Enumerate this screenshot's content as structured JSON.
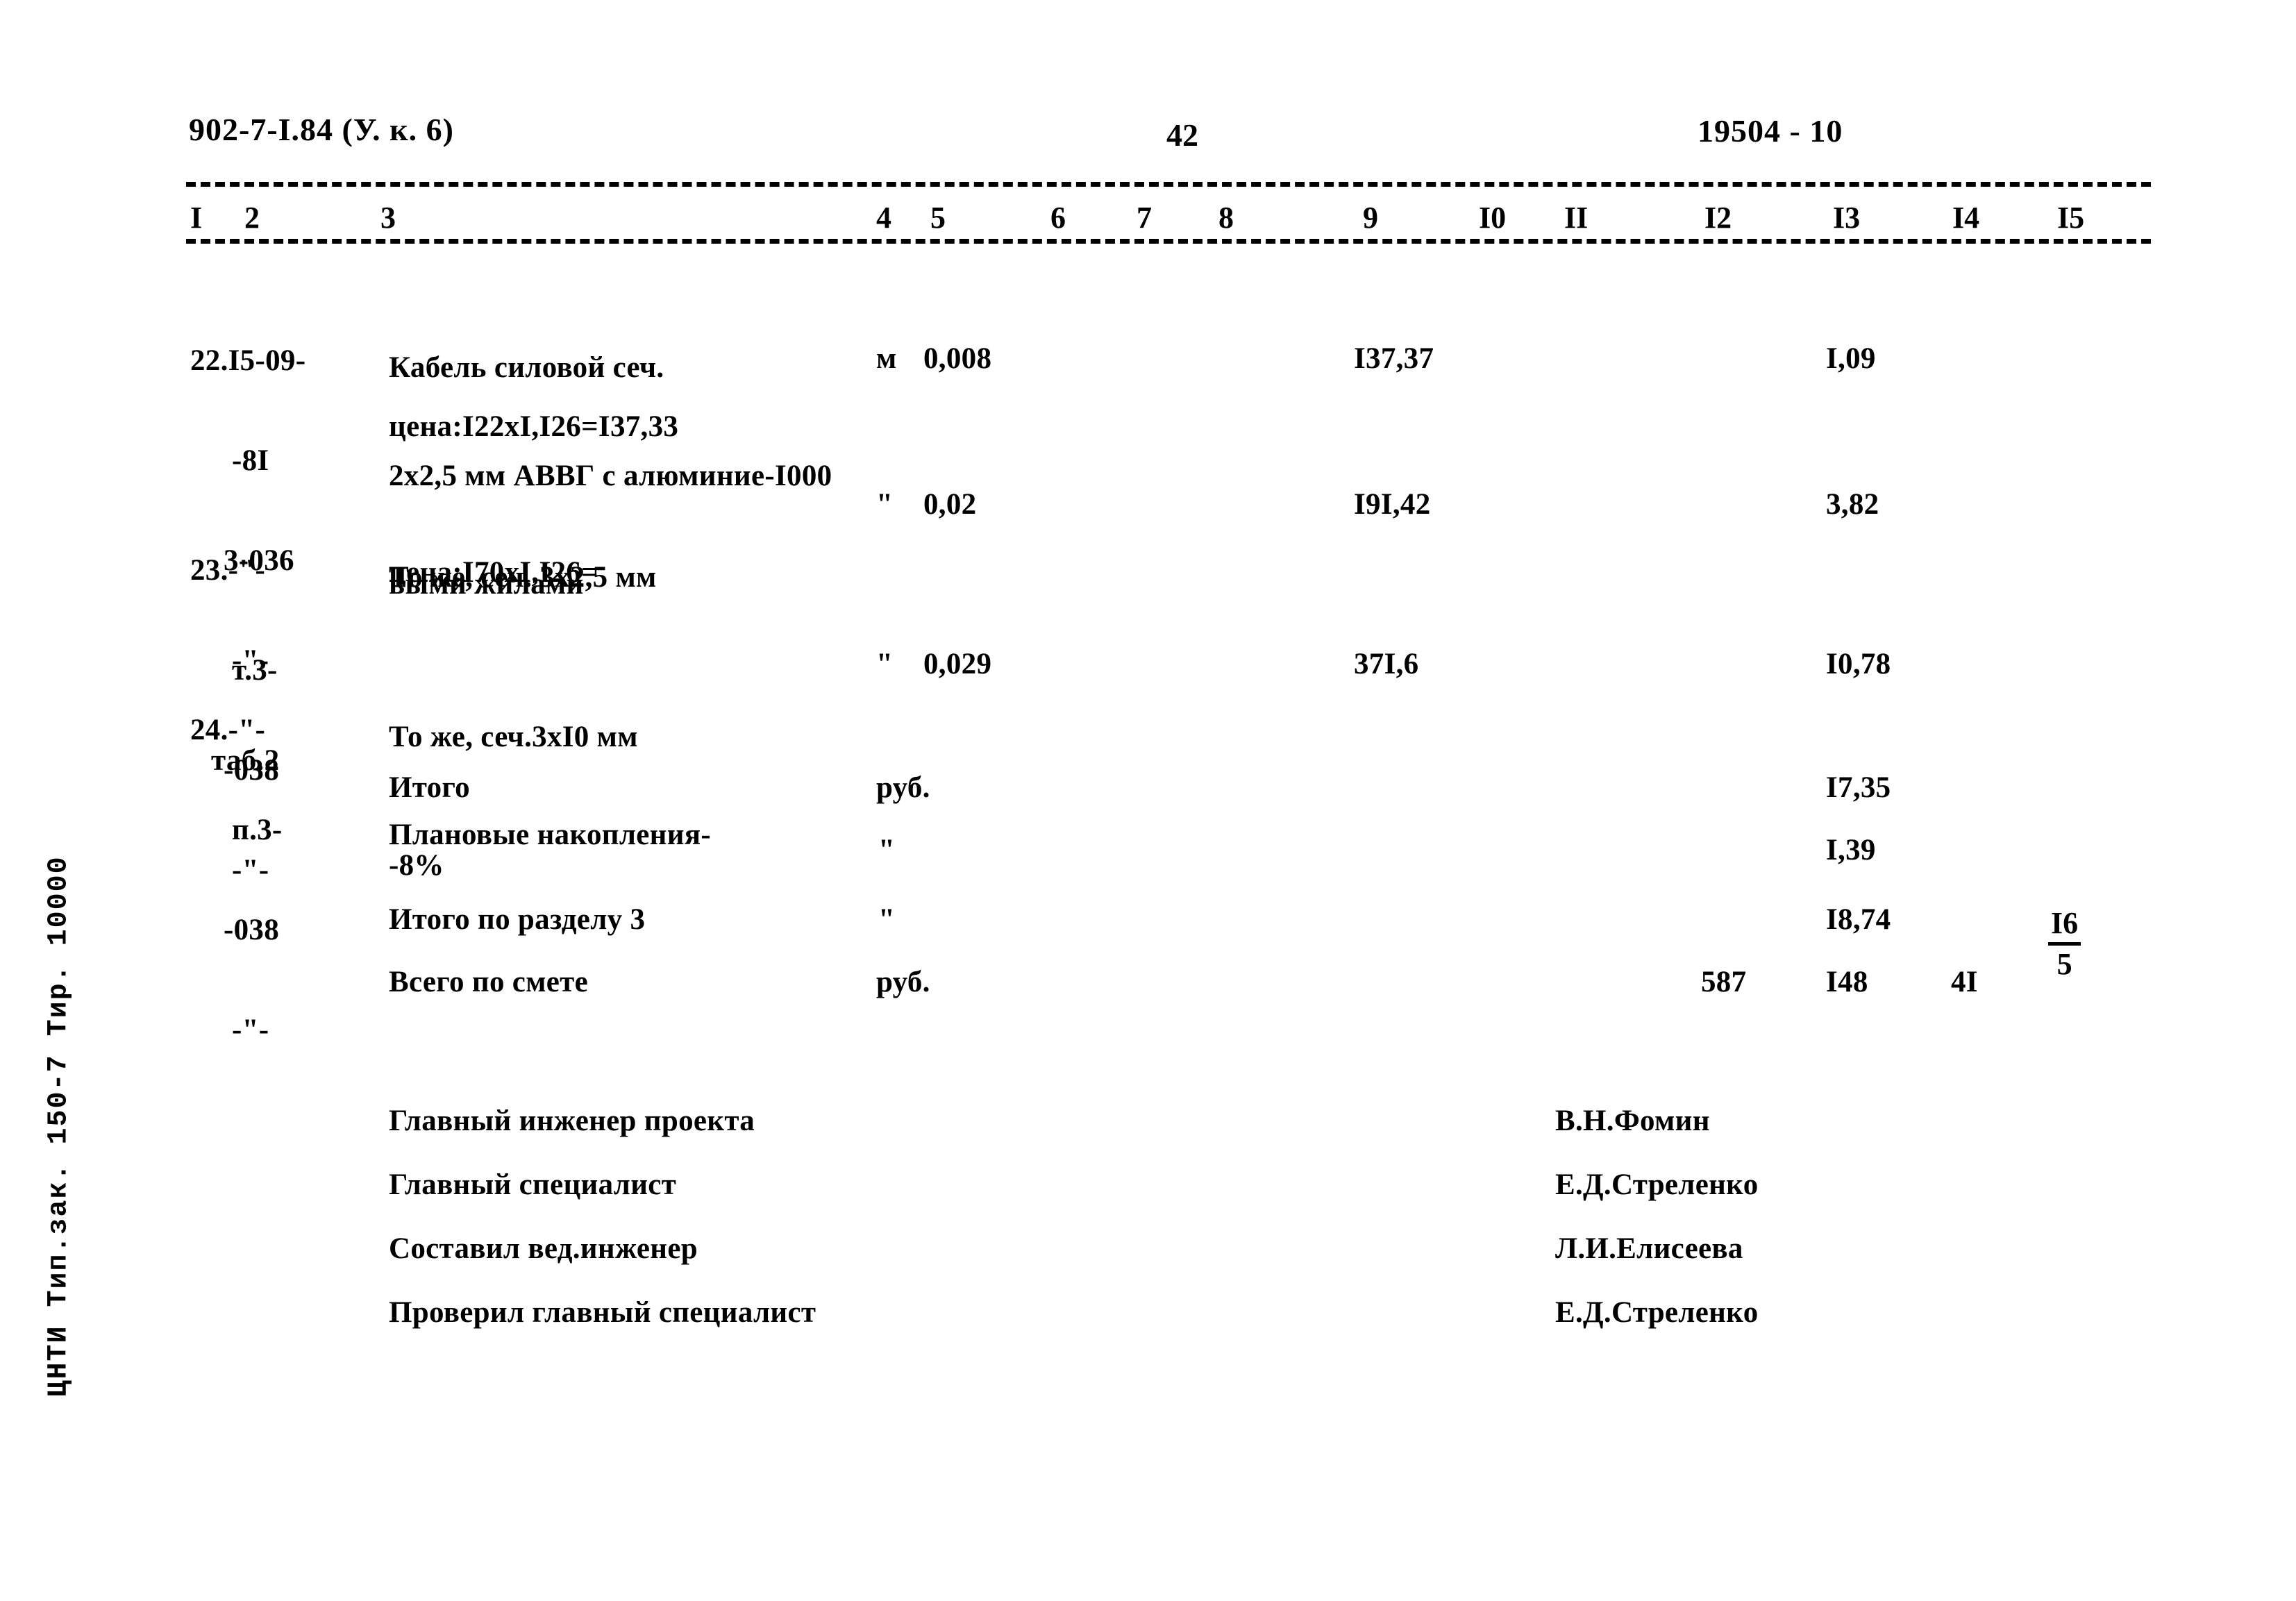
{
  "header": {
    "left_code": "902-7-I.84 (У. к. 6)",
    "page_number": "42",
    "right_code": "19504 - 10"
  },
  "table": {
    "column_numbers": [
      "I",
      "2",
      "3",
      "4",
      "5",
      "6",
      "7",
      "8",
      "9",
      "I0",
      "II",
      "I2",
      "I3",
      "I4",
      "I5"
    ],
    "rows": [
      {
        "no": "22.I5-09-",
        "code_lines": [
          "-8I",
          "3-036",
          "-\"-",
          "таб.2"
        ],
        "desc_lines": [
          "Кабель силовой сеч.",
          "2x2,5 мм АВВГ с алюминие-I000",
          "выми жилами"
        ],
        "price_note": "цена:I22xI,I26=I37,33",
        "unit": "м",
        "qty": "0,008",
        "unit_price": "I37,37",
        "total": "I,09"
      },
      {
        "no": "23.-\"-",
        "code_lines": [
          "т.3-",
          "-038",
          "-\"-"
        ],
        "desc_lines": [
          "То же, сеч. 3x2,5 мм"
        ],
        "price_note": "цена:I70xI,I26=",
        "unit": "\"",
        "qty": "0,02",
        "unit_price": "I9I,42",
        "total": "3,82"
      },
      {
        "no": "24.-\"-",
        "code_lines": [
          "п.3-",
          "-038",
          "-\"-"
        ],
        "desc_lines": [
          "То же, сеч.3xI0 мм"
        ],
        "price_note": "",
        "unit": "\"",
        "qty": "0,029",
        "unit_price": "37I,6",
        "total": "I0,78"
      }
    ],
    "summary": [
      {
        "label": "Итого",
        "label2": "",
        "unit": "руб.",
        "value": "I7,35",
        "c12": "",
        "c14": "",
        "frac_num": "",
        "frac_den": ""
      },
      {
        "label": "Плановые накопления-",
        "label2": "-8%",
        "unit": "\"",
        "value": "I,39",
        "c12": "",
        "c14": "",
        "frac_num": "",
        "frac_den": ""
      },
      {
        "label": "Итого по разделу 3",
        "label2": "",
        "unit": "\"",
        "value": "I8,74",
        "c12": "",
        "c14": "",
        "frac_num": "I6",
        "frac_den": "5"
      },
      {
        "label": "Всего по смете",
        "label2": "",
        "unit": "руб.",
        "value": "I48",
        "c12": "587",
        "c14": "4I",
        "frac_num": "",
        "frac_den": ""
      }
    ]
  },
  "signatures": [
    {
      "role": "Главный инженер проекта",
      "name": "В.Н.Фомин"
    },
    {
      "role": "Главный специалист",
      "name": "Е.Д.Стреленко"
    },
    {
      "role": "Составил вед.инженер",
      "name": "Л.И.Елисеева"
    },
    {
      "role": "Проверил главный специалист",
      "name": "Е.Д.Стреленко"
    }
  ],
  "side_imprint": "ЦНТИ Тип.зак. 150-7 Тир. 10000"
}
